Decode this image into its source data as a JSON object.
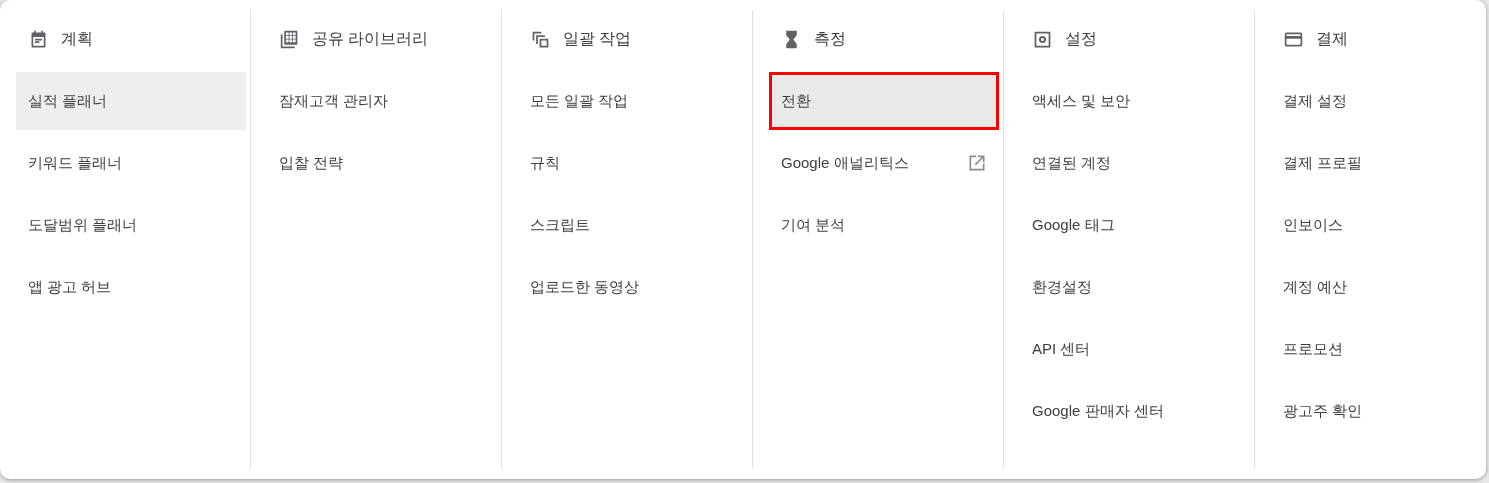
{
  "columns": [
    {
      "title": "계획",
      "kind": "calendar",
      "items": [
        {
          "label": "실적 플래너",
          "selected": true,
          "highlighted": false,
          "external": false
        },
        {
          "label": "키워드 플래너",
          "selected": false,
          "highlighted": false,
          "external": false
        },
        {
          "label": "도달범위 플래너",
          "selected": false,
          "highlighted": false,
          "external": false
        },
        {
          "label": "앱 광고 허브",
          "selected": false,
          "highlighted": false,
          "external": false
        }
      ]
    },
    {
      "title": "공유 라이브러리",
      "kind": "library",
      "items": [
        {
          "label": "잠재고객 관리자",
          "selected": false,
          "highlighted": false,
          "external": false
        },
        {
          "label": "입찰 전략",
          "selected": false,
          "highlighted": false,
          "external": false
        }
      ]
    },
    {
      "title": "일괄 작업",
      "kind": "copy",
      "items": [
        {
          "label": "모든 일괄 작업",
          "selected": false,
          "highlighted": false,
          "external": false
        },
        {
          "label": "규칙",
          "selected": false,
          "highlighted": false,
          "external": false
        },
        {
          "label": "스크립트",
          "selected": false,
          "highlighted": false,
          "external": false
        },
        {
          "label": "업로드한 동영상",
          "selected": false,
          "highlighted": false,
          "external": false
        }
      ]
    },
    {
      "title": "측정",
      "kind": "hourglass",
      "items": [
        {
          "label": "전환",
          "selected": true,
          "highlighted": true,
          "external": false
        },
        {
          "label": "Google 애널리틱스",
          "selected": false,
          "highlighted": false,
          "external": true
        },
        {
          "label": "기여 분석",
          "selected": false,
          "highlighted": false,
          "external": false
        }
      ]
    },
    {
      "title": "설정",
      "kind": "gear",
      "items": [
        {
          "label": "액세스 및 보안",
          "selected": false,
          "highlighted": false,
          "external": false
        },
        {
          "label": "연결된 계정",
          "selected": false,
          "highlighted": false,
          "external": false
        },
        {
          "label": "Google 태그",
          "selected": false,
          "highlighted": false,
          "external": false
        },
        {
          "label": "환경설정",
          "selected": false,
          "highlighted": false,
          "external": false
        },
        {
          "label": "API 센터",
          "selected": false,
          "highlighted": false,
          "external": false
        },
        {
          "label": "Google 판매자 센터",
          "selected": false,
          "highlighted": false,
          "external": false
        }
      ]
    },
    {
      "title": "결제",
      "kind": "card",
      "items": [
        {
          "label": "결제 설정",
          "selected": false,
          "highlighted": false,
          "external": false
        },
        {
          "label": "결제 프로필",
          "selected": false,
          "highlighted": false,
          "external": false
        },
        {
          "label": "인보이스",
          "selected": false,
          "highlighted": false,
          "external": false
        },
        {
          "label": "계정 예산",
          "selected": false,
          "highlighted": false,
          "external": false
        },
        {
          "label": "프로모션",
          "selected": false,
          "highlighted": false,
          "external": false
        },
        {
          "label": "광고주 확인",
          "selected": false,
          "highlighted": false,
          "external": false
        }
      ]
    }
  ]
}
